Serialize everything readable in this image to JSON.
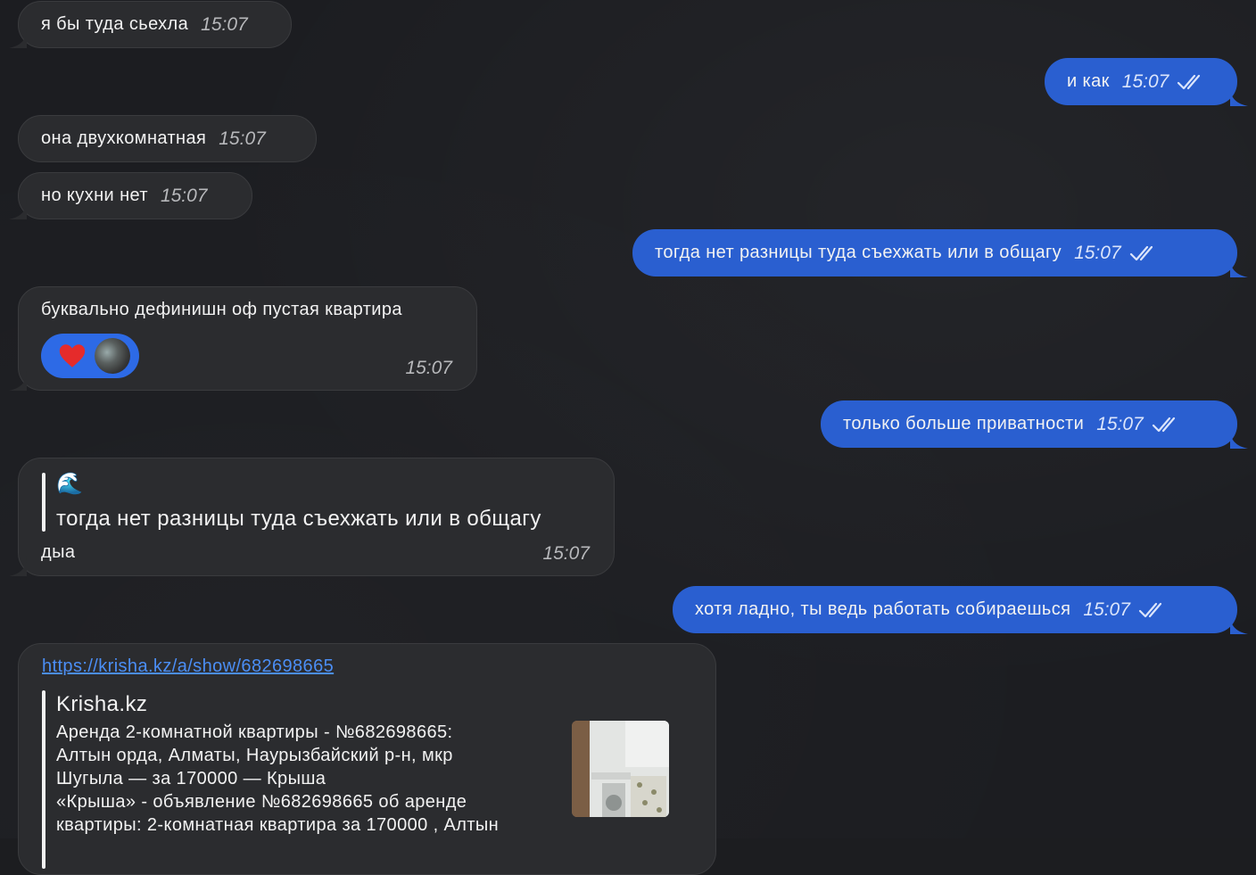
{
  "messages": [
    {
      "text": "я бы туда сьехла",
      "time": "15:07"
    },
    {
      "text": "и как",
      "time": "15:07"
    },
    {
      "text": "она двухкомнатная",
      "time": "15:07"
    },
    {
      "text": "но кухни нет",
      "time": "15:07"
    },
    {
      "text": "тогда нет разницы туда съехжать или в общагу",
      "time": "15:07"
    },
    {
      "text": "буквально дефинишн оф пустая квартира",
      "time": "15:07",
      "reactions": [
        "heart-icon",
        "avatar"
      ]
    },
    {
      "text": "только больше приватности",
      "time": "15:07"
    },
    {
      "quote_emoji": "🌊",
      "quote_text": "тогда нет разницы туда съехжать или в общагу",
      "text": "дыа",
      "time": "15:07"
    },
    {
      "text": "хотя ладно, ты ведь работать собираешься",
      "time": "15:07"
    },
    {
      "url": "https://krisha.kz/a/show/682698665",
      "preview_site": "Krisha.kz",
      "preview_lines": [
        "Аренда 2-комнатной квартиры - №682698665:",
        "Алтын орда, Алматы, Наурызбайский р-н, мкр",
        "Шугыла — за 170000 — Крыша",
        "«Крыша» - объявление №682698665 об аренде",
        "квартиры: 2-комнатная квартира за 170000 , Алтын"
      ]
    }
  ],
  "colors": {
    "outgoing": "#2a5fd0",
    "incoming": "#2b2c2f",
    "background": "#1c1d21"
  }
}
